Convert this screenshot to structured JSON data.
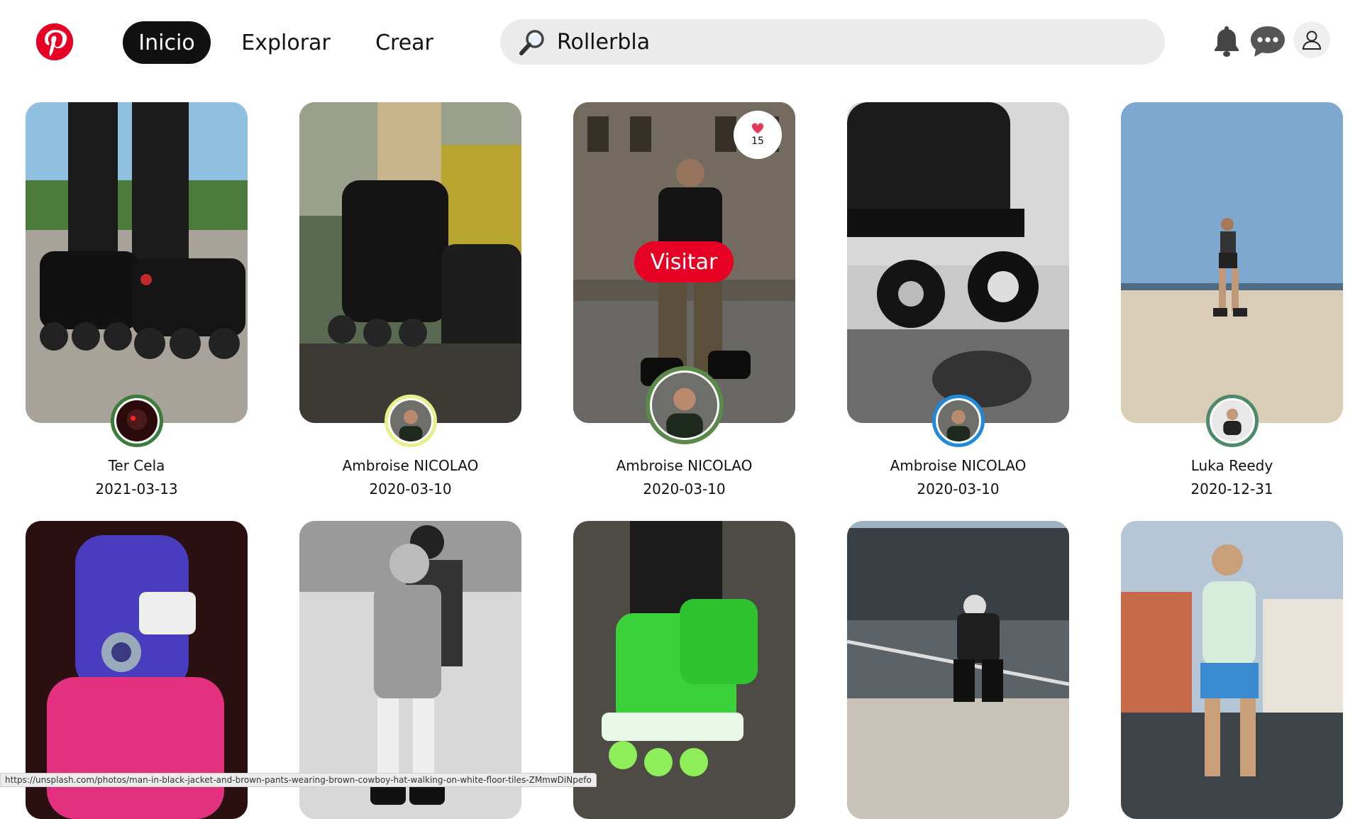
{
  "header": {
    "nav": {
      "home_label": "Inicio",
      "explore_label": "Explorar",
      "create_label": "Crear"
    },
    "search": {
      "value": "Rollerbla",
      "placeholder": ""
    },
    "icons": [
      "pinterest-logo-icon",
      "bell-icon",
      "chat-bubble-icon",
      "user-icon"
    ]
  },
  "pins": [
    {
      "author": "Ter Cela",
      "date": "2021-03-13"
    },
    {
      "author": "Ambroise NICOLAO",
      "date": "2020-03-10"
    },
    {
      "author": "Ambroise NICOLAO",
      "date": "2020-03-10",
      "hovered": true,
      "visit_label": "Visitar",
      "likes": "15"
    },
    {
      "author": "Ambroise NICOLAO",
      "date": "2020-03-10"
    },
    {
      "author": "Luka Reedy",
      "date": "2020-12-31"
    },
    {
      "author": "",
      "date": ""
    },
    {
      "author": "",
      "date": ""
    },
    {
      "author": "",
      "date": ""
    },
    {
      "author": "",
      "date": ""
    },
    {
      "author": "",
      "date": ""
    }
  ],
  "status_bar": {
    "url": "https://unsplash.com/photos/man-in-black-jacket-and-brown-pants-wearing-brown-cowboy-hat-walking-on-white-floor-tiles-ZMmwDiNpefo"
  },
  "colors": {
    "brand": "#e60023",
    "active_nav": "#111111",
    "search_bg": "#ebebeb"
  }
}
